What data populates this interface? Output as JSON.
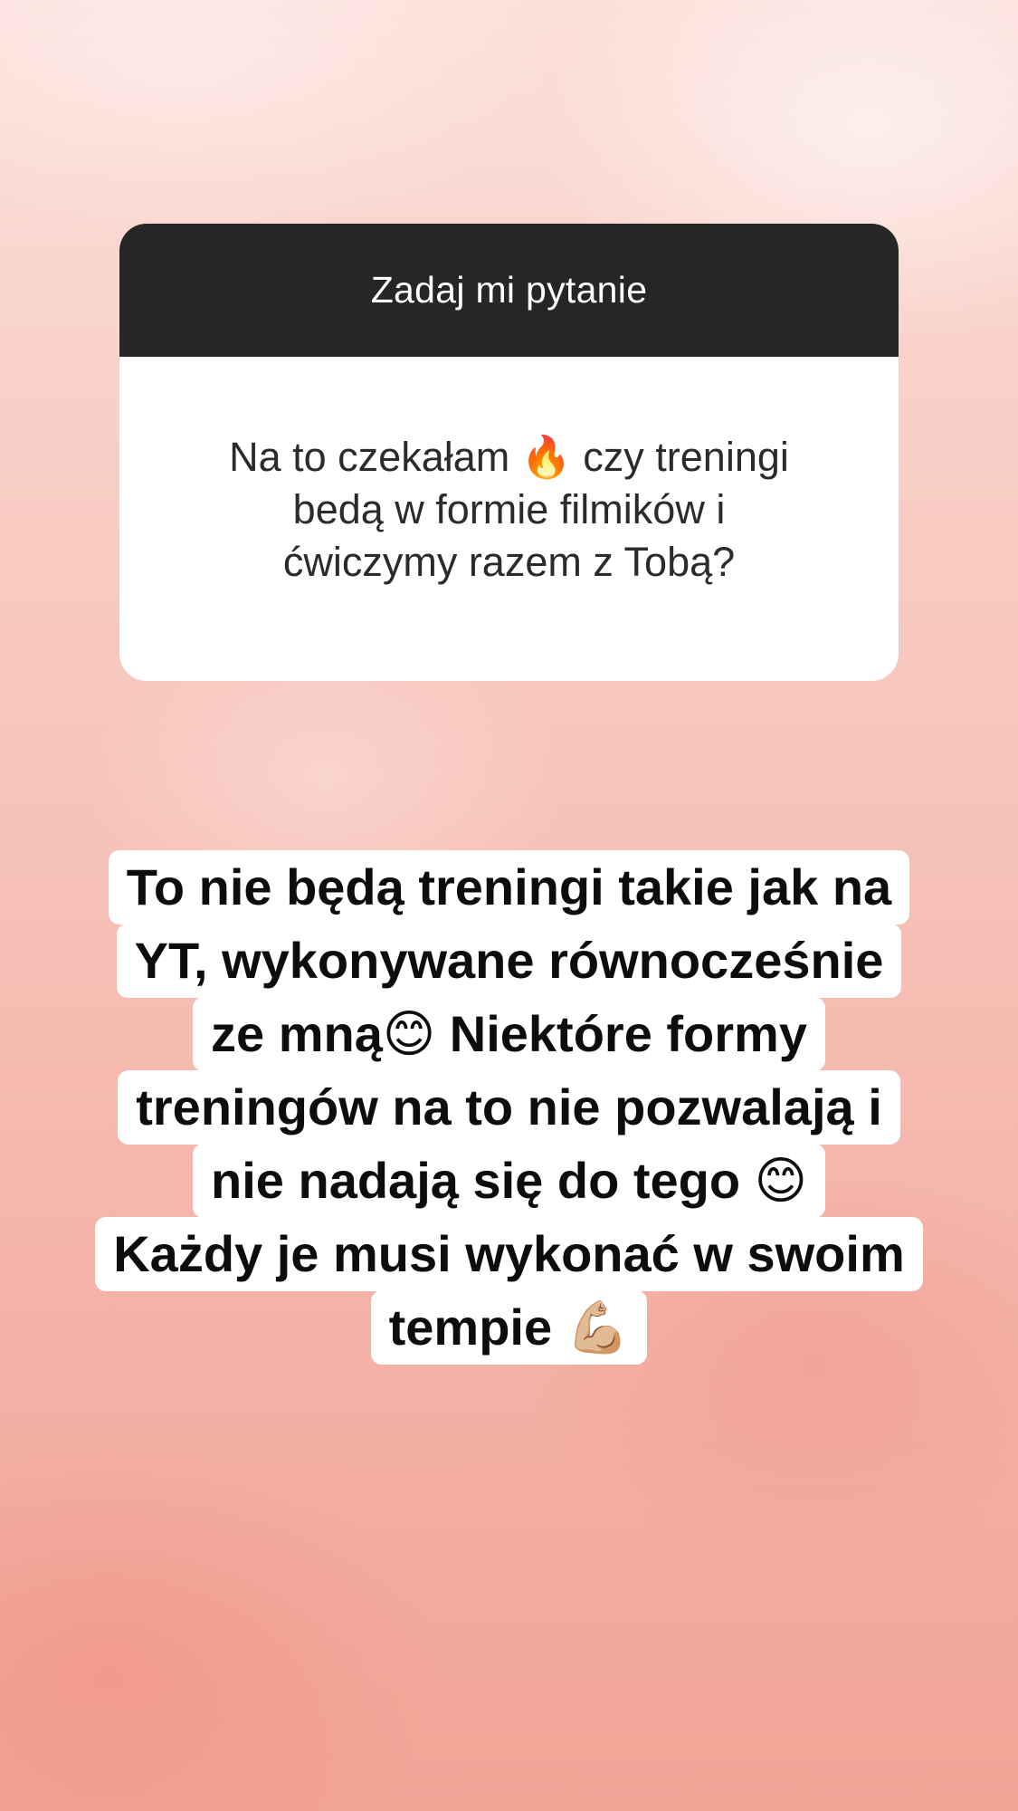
{
  "question": {
    "header": "Zadaj mi pytanie",
    "text": "Na to czekałam 🔥 czy treningi\nbedą w formie filmików i\nćwiczymy razem z Tobą?"
  },
  "answer": {
    "lines": [
      "To nie będą treningi takie jak na",
      "YT, wykonywane równocześnie",
      "ze mną😊 Niektóre formy",
      "treningów na to nie pozwalają i",
      "nie nadają się do tego 😊",
      "Każdy je musi wykonać w swoim",
      "tempie 💪🏼"
    ]
  }
}
